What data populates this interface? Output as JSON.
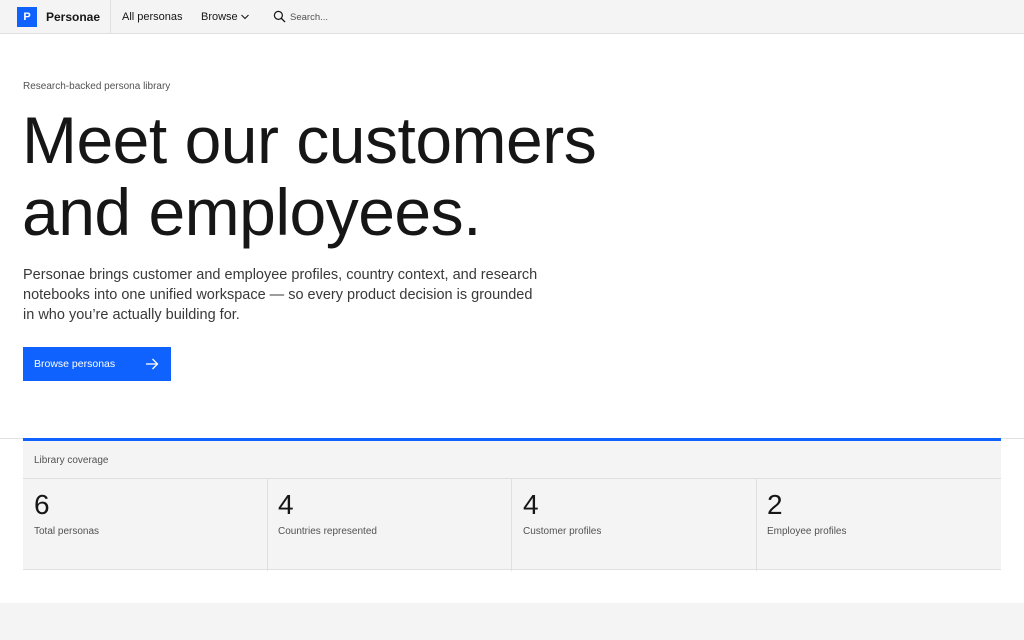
{
  "header": {
    "logo_letter": "P",
    "brand": "Personae",
    "nav_all": "All personas",
    "nav_browse": "Browse",
    "search_placeholder": "Search..."
  },
  "hero": {
    "eyebrow": "Research-backed persona library",
    "headline_line1": "Meet our customers",
    "headline_line2": "and employees.",
    "lead": "Personae brings customer and employee profiles, country context, and research notebooks into one unified workspace — so every product decision is grounded in who you’re actually building for.",
    "cta_label": "Browse personas"
  },
  "stats": {
    "title": "Library coverage",
    "items": [
      {
        "value": "6",
        "label": "Total personas"
      },
      {
        "value": "4",
        "label": "Countries represented"
      },
      {
        "value": "4",
        "label": "Customer profiles"
      },
      {
        "value": "2",
        "label": "Employee profiles"
      }
    ]
  },
  "colors": {
    "accent": "#0f62fe",
    "surface": "#f4f4f4",
    "border": "#e0e0e0"
  }
}
